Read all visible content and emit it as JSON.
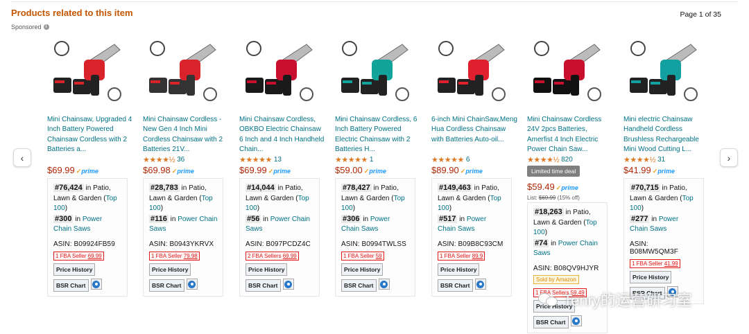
{
  "header": {
    "title": "Products related to this item",
    "page": "Page 1 of 35",
    "sponsored": "Sponsored",
    "info_glyph": "i"
  },
  "nav": {
    "prev": "‹",
    "next": "›"
  },
  "labels": {
    "prime": "prime",
    "asin_prefix": "ASIN: ",
    "price_history": "Price History",
    "bsr_chart": "BSR Chart",
    "in": " in ",
    "top": "Top 100"
  },
  "products": [
    {
      "title": "Mini Chainsaw, Upgraded 4 Inch Battery Powered Chainsaw Cordless with 2 Batteries a...",
      "stars": "",
      "rating_count": "",
      "price": "$69.99",
      "rank1": "#76,424",
      "cat1": "Patio, Lawn & Garden",
      "rank2": "#300",
      "cat2": "Power Chain Saws",
      "asin": "B09924FB59",
      "fba_label": "1 FBA Seller",
      "fba_price": "69.99"
    },
    {
      "title": "Mini Chainsaw Cordless - New Gen 4 Inch Mini Cordless Chainsaw with 2 Batteries 21V...",
      "stars": "★★★★½",
      "rating_count": "36",
      "price": "$69.98",
      "rank1": "#28,783",
      "cat1": "Patio, Lawn & Garden",
      "rank2": "#116",
      "cat2": "Power Chain Saws",
      "asin": "B0943YKRVX",
      "fba_label": "1 FBA Seller",
      "fba_price": "79.98"
    },
    {
      "title": "Mini Chainsaw Cordless, OBKBO Electric Chainsaw 6 Inch and 4 Inch Handheld Chain...",
      "stars": "★★★★★",
      "rating_count": "13",
      "price": "$69.99",
      "rank1": "#14,044",
      "cat1": "Patio, Lawn & Garden",
      "rank2": "#56",
      "cat2": "Power Chain Saws",
      "asin": "B097PCDZ4C",
      "fba_label": "2 FBA Sellers",
      "fba_price": "69.99"
    },
    {
      "title": "Mini Chainsaw Cordless, 6 Inch Battery Powered Electric Chainsaw with 2 Batteries H...",
      "stars": "★★★★★",
      "rating_count": "1",
      "price": "$59.00",
      "rank1": "#78,427",
      "cat1": "Patio, Lawn & Garden",
      "rank2": "#306",
      "cat2": "Power Chain Saws",
      "asin": "B0994TWLSS",
      "fba_label": "1 FBA Seller",
      "fba_price": "59"
    },
    {
      "title": "6-inch Mini ChainSaw,Meng Hua Cordless Chainsaw with Batteries Auto-oil...",
      "stars": "★★★★★",
      "rating_count": "6",
      "price": "$89.90",
      "rank1": "#149,463",
      "cat1": "Patio, Lawn & Garden",
      "rank2": "#517",
      "cat2": "Power Chain Saws",
      "asin": "B09B8C93CM",
      "fba_label": "1 FBA Seller",
      "fba_price": "89.9"
    },
    {
      "title": "Mini Chainsaw Cordless 24V 2pcs Batteries, Amerfist 4 Inch Electric Power Chain Saw...",
      "stars": "★★★★½",
      "rating_count": "820",
      "deal": "Limited time deal",
      "price": "$59.49",
      "list_label": "List: ",
      "list_price": "$69.99",
      "discount": " (15% off)",
      "rank1": "#18,263",
      "cat1": "Patio, Lawn & Garden",
      "rank2": "#74",
      "cat2": "Power Chain Saws",
      "asin": "B08QV9HJYR",
      "sold_by": "Sold by Amazon",
      "fba_label": "1 FBA Sellers",
      "fba_price": "59.49"
    },
    {
      "title": "Mini electric Chainsaw Handheld Cordless Brushless Rechargeable Mini Wood Cutting L...",
      "stars": "★★★★½",
      "rating_count": "31",
      "price": "$41.99",
      "rank1": "#70,715",
      "cat1": "Patio, Lawn & Garden",
      "rank2": "#277",
      "cat2": "Power Chain Saws",
      "asin": "B08MW5QM3F",
      "fba_label": "1 FBA Seller",
      "fba_price": "41.99"
    }
  ],
  "watermark": "Tenry的运营研习室",
  "colors": {
    "accent": "#c45500",
    "link": "#007185",
    "price": "#b12704",
    "star": "#de7921",
    "fba_red": "#e01b1b"
  }
}
